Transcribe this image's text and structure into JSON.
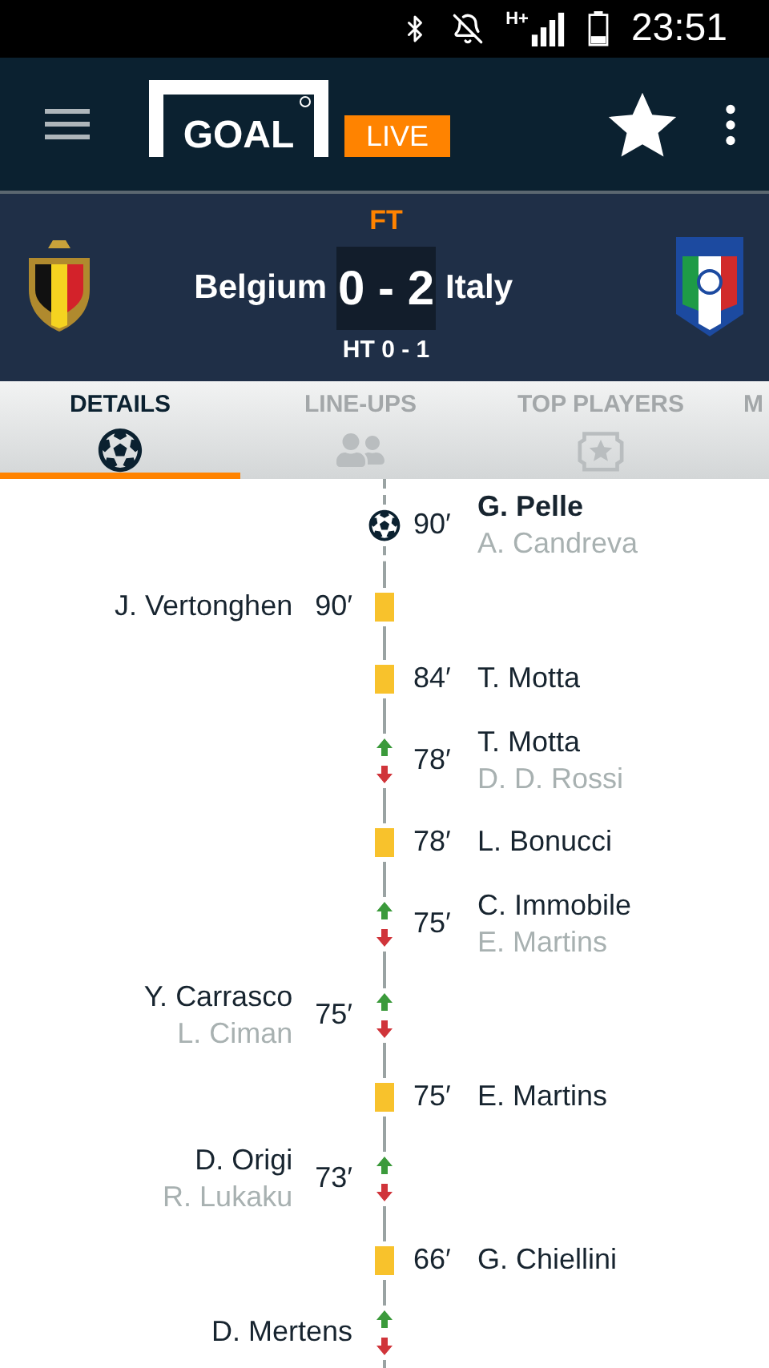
{
  "status_bar": {
    "network": "H+",
    "time": "23:51"
  },
  "app_bar": {
    "logo": "GOAL",
    "badge": "LIVE"
  },
  "match": {
    "status": "FT",
    "home": "Belgium",
    "score": "0 - 2",
    "away": "Italy",
    "half_time": "HT 0 - 1"
  },
  "tabs": [
    {
      "label": "DETAILS",
      "selected": true
    },
    {
      "label": "LINE-UPS",
      "selected": false
    },
    {
      "label": "TOP PLAYERS",
      "selected": false
    },
    {
      "label": "M",
      "selected": false
    }
  ],
  "events": [
    {
      "kind": "goal",
      "minute": "90′",
      "away": {
        "player": "G. Pelle",
        "secondary": "A. Candreva"
      }
    },
    {
      "kind": "yellow",
      "minute": "90′",
      "home": {
        "player": "J. Vertonghen"
      }
    },
    {
      "kind": "yellow",
      "minute": "84′",
      "away": {
        "player": "T. Motta"
      }
    },
    {
      "kind": "sub",
      "minute": "78′",
      "away": {
        "player": "T. Motta",
        "secondary": "D. D. Rossi"
      }
    },
    {
      "kind": "yellow",
      "minute": "78′",
      "away": {
        "player": "L. Bonucci"
      }
    },
    {
      "kind": "sub",
      "minute": "75′",
      "away": {
        "player": "C. Immobile",
        "secondary": "E. Martins"
      }
    },
    {
      "kind": "sub",
      "minute": "75′",
      "home": {
        "player": "Y. Carrasco",
        "secondary": "L. Ciman"
      }
    },
    {
      "kind": "yellow",
      "minute": "75′",
      "away": {
        "player": "E. Martins"
      }
    },
    {
      "kind": "sub",
      "minute": "73′",
      "home": {
        "player": "D. Origi",
        "secondary": "R. Lukaku"
      }
    },
    {
      "kind": "yellow",
      "minute": "66′",
      "away": {
        "player": "G. Chiellini"
      }
    },
    {
      "kind": "sub",
      "home": {
        "player": "D. Mertens"
      }
    }
  ]
}
